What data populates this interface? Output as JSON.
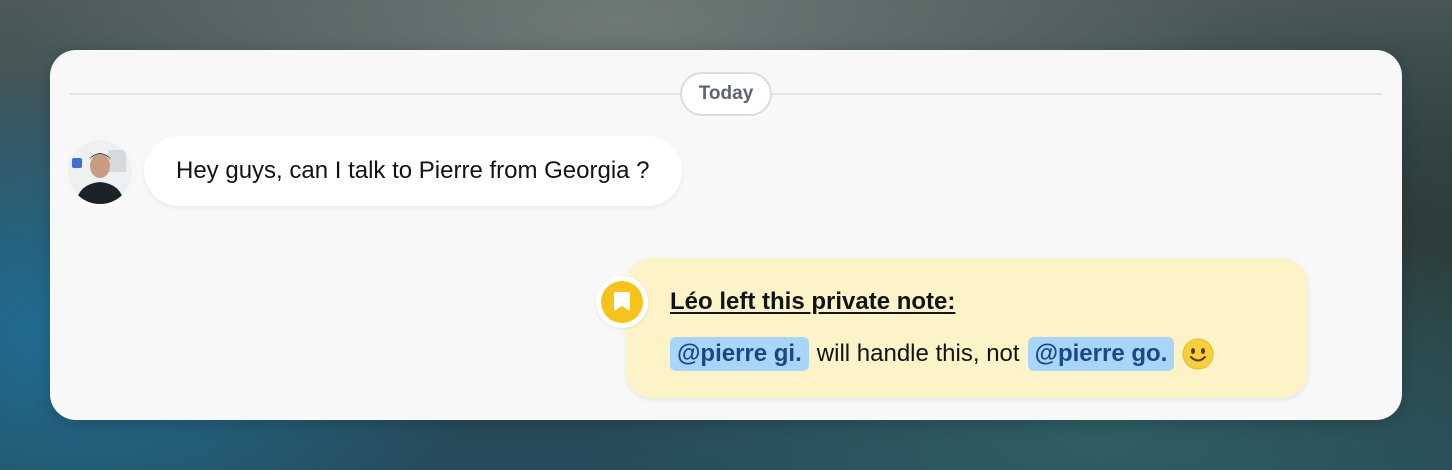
{
  "chat": {
    "day_label": "Today",
    "incoming": {
      "text": "Hey guys, can I talk to Pierre from Georgia ?"
    },
    "private_note": {
      "title": "Léo left this private note:",
      "mention_1": "@pierre gi.",
      "middle_text": "will handle this, not",
      "mention_2": "@pierre go.",
      "emoji": "slightly-smiling-face"
    }
  },
  "colors": {
    "card_background": "#f8f8f8",
    "note_background": "#fdf3c9",
    "note_badge": "#f6c31a",
    "mention_background": "#a9d5fb",
    "mention_text": "#174a80"
  }
}
